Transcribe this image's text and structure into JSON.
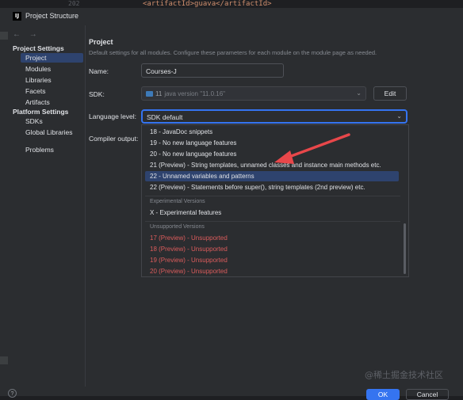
{
  "background_code": {
    "line_number": "202",
    "code_text": "<artifactId>guava</artifactId>"
  },
  "titlebar": {
    "app_icon_text": "IJ",
    "title": "Project Structure"
  },
  "nav": {
    "back": "←",
    "forward": "→"
  },
  "sidebar": {
    "project_settings_header": "Project Settings",
    "project_items": [
      "Project",
      "Modules",
      "Libraries",
      "Facets",
      "Artifacts"
    ],
    "selected_item": "Project",
    "platform_settings_header": "Platform Settings",
    "platform_items": [
      "SDKs",
      "Global Libraries"
    ],
    "problems": "Problems"
  },
  "main": {
    "title": "Project",
    "description": "Default settings for all modules. Configure these parameters for each module on the module page as needed.",
    "name_label": "Name:",
    "name_value": "Courses-J",
    "sdk_label": "SDK:",
    "sdk_value": "11",
    "sdk_version": "java version \"11.0.16\"",
    "edit_label": "Edit",
    "language_level_label": "Language level:",
    "language_level_value": "SDK default",
    "compiler_output_label": "Compiler output:"
  },
  "dropdown": {
    "options": [
      "18 - JavaDoc snippets",
      "19 - No new language features",
      "20 - No new language features",
      "21 (Preview) - String templates, unnamed classes and instance main methods etc.",
      "22 - Unnamed variables and patterns",
      "22 (Preview) - Statements before super(), string templates (2nd preview) etc."
    ],
    "selected_option": "22 - Unnamed variables and patterns",
    "experimental_header": "Experimental Versions",
    "experimental_options": [
      "X - Experimental features"
    ],
    "unsupported_header": "Unsupported Versions",
    "unsupported_options": [
      "17 (Preview) - Unsupported",
      "18 (Preview) - Unsupported",
      "19 (Preview) - Unsupported",
      "20 (Preview) - Unsupported"
    ]
  },
  "footer": {
    "help_label": "?",
    "ok_label": "OK",
    "cancel_label": "Cancel"
  },
  "watermark": "@稀土掘金技术社区",
  "colors": {
    "accent": "#3574f0",
    "selection": "#2e436e",
    "unsupported": "#db5c5c",
    "annotation_arrow": "#e8474a"
  },
  "icons": {
    "sdk_folder": "folder-icon",
    "dropdown_chevron": "chevron-down-icon"
  }
}
